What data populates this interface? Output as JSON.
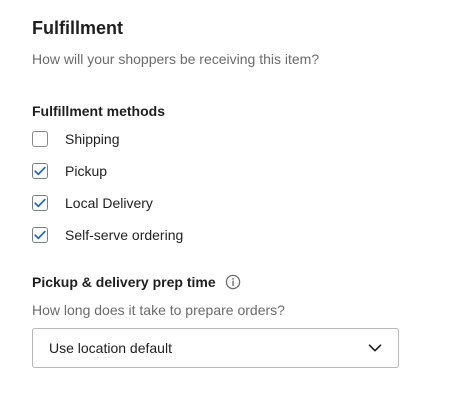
{
  "section": {
    "title": "Fulfillment",
    "subtitle": "How will your shoppers be receiving this item?"
  },
  "methods": {
    "label": "Fulfillment methods",
    "items": [
      {
        "label": "Shipping",
        "checked": false
      },
      {
        "label": "Pickup",
        "checked": true
      },
      {
        "label": "Local Delivery",
        "checked": true
      },
      {
        "label": "Self-serve ordering",
        "checked": true
      }
    ]
  },
  "prep_time": {
    "label": "Pickup & delivery prep time",
    "info_icon": "info-icon",
    "help": "How long does it take to prepare orders?",
    "select": {
      "value": "Use location default",
      "icon": "chevron-down-icon"
    }
  },
  "colors": {
    "check_mark": "#1a5fd1",
    "text_primary": "#1f1f1f",
    "text_secondary": "#6b6b6b",
    "border": "#b8b8b8"
  }
}
